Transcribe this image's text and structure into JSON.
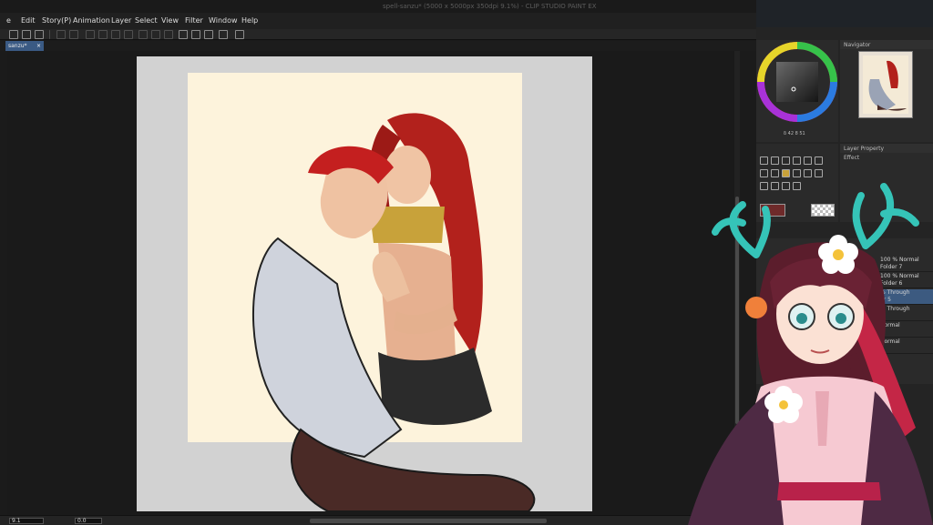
{
  "window": {
    "title": "spell-sanzu* (5000 x 5000px 350dpi 9.1%) - CLIP STUDIO PAINT EX"
  },
  "menu": {
    "items": [
      "e",
      "Edit",
      "Story(P)",
      "Animation",
      "Layer",
      "Select",
      "View",
      "Filter",
      "Window",
      "Help"
    ]
  },
  "document_tab": {
    "label": "sanzu*",
    "close": "×"
  },
  "status": {
    "zoom": "9.1",
    "angle": "0.0"
  },
  "panels": {
    "navigator_label": "Navigator",
    "layer_property_label": "Layer Property",
    "effect_label": "Effect",
    "color_values": "δ 42 8 51",
    "layers": [
      {
        "text": "100 % Normal\nFolder 7"
      },
      {
        "text": "100 % Normal\nFolder 6"
      },
      {
        "text": "% Through\ner 5"
      },
      {
        "text": "% Through\n4"
      },
      {
        "text": "Normal"
      },
      {
        "text": "Normal"
      }
    ]
  },
  "colors": {
    "accent": "#3a5a84",
    "paper": "#d2d2d2",
    "artboard": "#fdf3dc"
  }
}
